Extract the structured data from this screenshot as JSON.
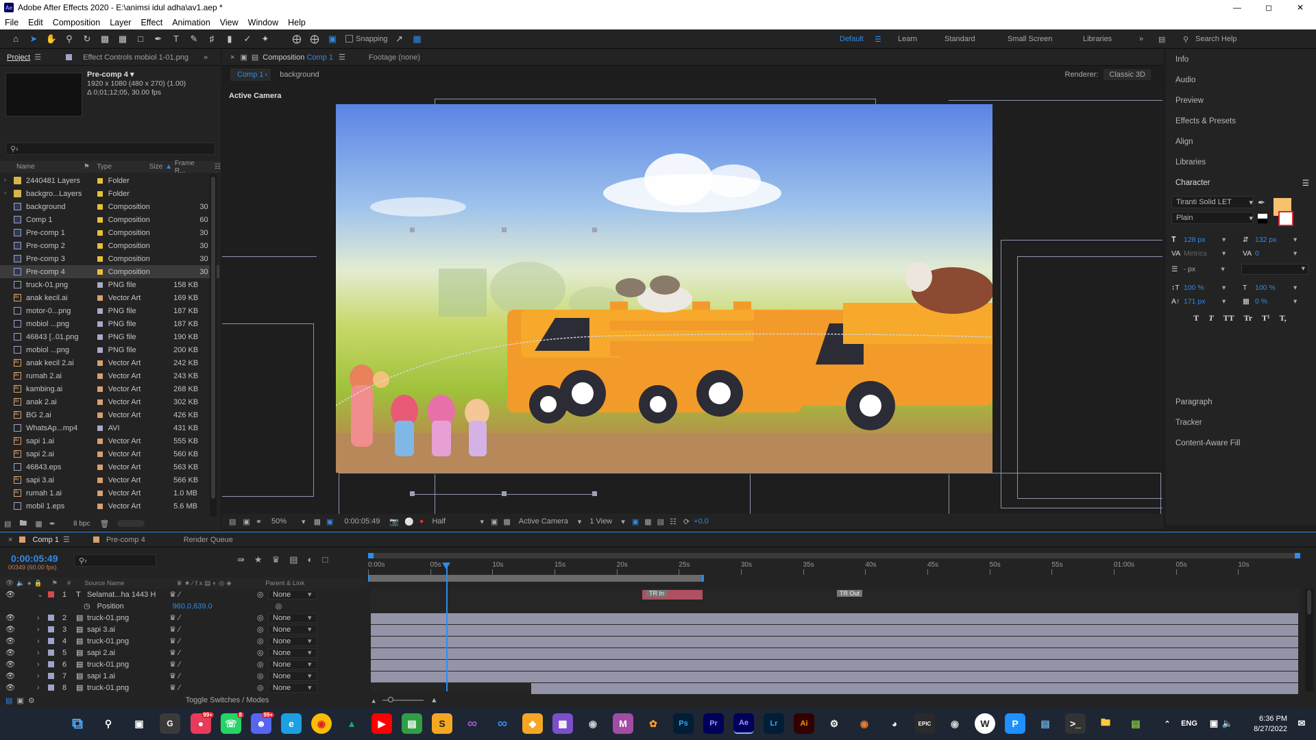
{
  "window": {
    "title": "Adobe After Effects 2020 - E:\\animsi idul adha\\av1.aep *",
    "app_icon": "Ae",
    "controls": [
      "minimize",
      "maximize",
      "close"
    ]
  },
  "menu": [
    "File",
    "Edit",
    "Composition",
    "Layer",
    "Effect",
    "Animation",
    "View",
    "Window",
    "Help"
  ],
  "toolbar": {
    "snapping_label": "Snapping",
    "workspaces": [
      "Default",
      "Learn",
      "Standard",
      "Small Screen",
      "Libraries"
    ],
    "active_workspace": "Default",
    "search_help": "Search Help"
  },
  "project_panel": {
    "tab_project": "Project",
    "tab_effect_controls": "Effect Controls mobiol 1-01.png",
    "selected_item": {
      "name": "Pre-comp 4",
      "resolution": "1920 x 1080  (480 x 270) (1.00)",
      "duration": "Δ 0;01;12;05, 30.00 fps"
    },
    "search_placeholder": "",
    "columns": [
      "Name",
      "Type",
      "Size",
      "Frame R..."
    ],
    "items": [
      {
        "name": "2440481 Layers",
        "type": "Folder",
        "size": "",
        "fr": "",
        "color": "#e8c03a",
        "icon": "folder"
      },
      {
        "name": "backgro...Layers",
        "type": "Folder",
        "size": "",
        "fr": "",
        "color": "#e8c03a",
        "icon": "folder"
      },
      {
        "name": "background",
        "type": "Composition",
        "size": "",
        "fr": "30",
        "color": "#e8c03a",
        "icon": "comp"
      },
      {
        "name": "Comp 1",
        "type": "Composition",
        "size": "",
        "fr": "60",
        "color": "#e8c03a",
        "icon": "comp"
      },
      {
        "name": "Pre-comp 1",
        "type": "Composition",
        "size": "",
        "fr": "30",
        "color": "#e8c03a",
        "icon": "comp"
      },
      {
        "name": "Pre-comp 2",
        "type": "Composition",
        "size": "",
        "fr": "30",
        "color": "#e8c03a",
        "icon": "comp"
      },
      {
        "name": "Pre-comp 3",
        "type": "Composition",
        "size": "",
        "fr": "30",
        "color": "#e8c03a",
        "icon": "comp"
      },
      {
        "name": "Pre-comp 4",
        "type": "Composition",
        "size": "",
        "fr": "30",
        "color": "#e8c03a",
        "icon": "comp",
        "selected": true
      },
      {
        "name": "truck-01.png",
        "type": "PNG file",
        "size": "158 KB",
        "fr": "",
        "color": "#a9a9c8",
        "icon": "file"
      },
      {
        "name": "anak kecil.ai",
        "type": "Vector Art",
        "size": "169 KB",
        "fr": "",
        "color": "#d8a070",
        "icon": "ai"
      },
      {
        "name": "motor-0...png",
        "type": "PNG file",
        "size": "187 KB",
        "fr": "",
        "color": "#a9a9c8",
        "icon": "file"
      },
      {
        "name": "mobiol ...png",
        "type": "PNG file",
        "size": "187 KB",
        "fr": "",
        "color": "#a9a9c8",
        "icon": "file"
      },
      {
        "name": "46843 [..01.png",
        "type": "PNG file",
        "size": "190 KB",
        "fr": "",
        "color": "#a9a9c8",
        "icon": "file"
      },
      {
        "name": "mobiol ...png",
        "type": "PNG file",
        "size": "200 KB",
        "fr": "",
        "color": "#a9a9c8",
        "icon": "file"
      },
      {
        "name": "anak kecil 2.ai",
        "type": "Vector Art",
        "size": "242 KB",
        "fr": "",
        "color": "#d8a070",
        "icon": "ai"
      },
      {
        "name": "rumah 2.ai",
        "type": "Vector Art",
        "size": "243 KB",
        "fr": "",
        "color": "#d8a070",
        "icon": "ai"
      },
      {
        "name": "kambing.ai",
        "type": "Vector Art",
        "size": "268 KB",
        "fr": "",
        "color": "#d8a070",
        "icon": "ai"
      },
      {
        "name": "anak 2.ai",
        "type": "Vector Art",
        "size": "302 KB",
        "fr": "",
        "color": "#d8a070",
        "icon": "ai"
      },
      {
        "name": "BG 2.ai",
        "type": "Vector Art",
        "size": "426 KB",
        "fr": "",
        "color": "#d8a070",
        "icon": "ai"
      },
      {
        "name": "WhatsAp...mp4",
        "type": "AVI",
        "size": "431 KB",
        "fr": "",
        "color": "#a9a9c8",
        "icon": "file"
      },
      {
        "name": "sapi 1.ai",
        "type": "Vector Art",
        "size": "555 KB",
        "fr": "",
        "color": "#d8a070",
        "icon": "ai"
      },
      {
        "name": "sapi 2.ai",
        "type": "Vector Art",
        "size": "560 KB",
        "fr": "",
        "color": "#d8a070",
        "icon": "ai"
      },
      {
        "name": "46843.eps",
        "type": "Vector Art",
        "size": "563 KB",
        "fr": "",
        "color": "#d8a070",
        "icon": "eps"
      },
      {
        "name": "sapi 3.ai",
        "type": "Vector Art",
        "size": "566 KB",
        "fr": "",
        "color": "#d8a070",
        "icon": "ai"
      },
      {
        "name": "rumah 1.ai",
        "type": "Vector Art",
        "size": "1.0 MB",
        "fr": "",
        "color": "#d8a070",
        "icon": "ai"
      },
      {
        "name": "mobil 1.eps",
        "type": "Vector Art",
        "size": "5.6 MB",
        "fr": "",
        "color": "#d8a070",
        "icon": "eps"
      }
    ],
    "bpc": "8 bpc"
  },
  "composition_panel": {
    "tab_label": "Composition",
    "tab_comp": "Comp 1",
    "tab_footage": "Footage (none)",
    "breadcrumbs": [
      "Comp 1",
      "background"
    ],
    "renderer_label": "Renderer:",
    "renderer_value": "Classic 3D",
    "view_label": "Active Camera",
    "zoom": "50%",
    "timecode": "0:00:05:49",
    "resolution": "Half",
    "camera": "Active Camera",
    "views": "1 View",
    "exposure": "+0.0"
  },
  "right_panels": {
    "items": [
      "Info",
      "Audio",
      "Preview",
      "Effects & Presets",
      "Align",
      "Libraries"
    ],
    "character": {
      "title": "Character",
      "font": "Tiranti Solid LET",
      "style": "Plain",
      "size": "128 px",
      "leading": "132 px",
      "kerning": "Metrics",
      "tracking": "0",
      "stroke": "- px",
      "vscale": "100 %",
      "hscale": "100 %",
      "baseline": "171 px",
      "tsume": "0 %",
      "fill_color": "#f7c270",
      "style_buttons": [
        "T",
        "T",
        "TT",
        "Tr",
        "T¹",
        "T,"
      ]
    },
    "bottom_items": [
      "Paragraph",
      "Tracker",
      "Content-Aware Fill"
    ]
  },
  "timeline": {
    "tab_comp": "Comp 1",
    "tab_precomp": "Pre-comp 4",
    "tab_render": "Render Queue",
    "current_time": "0:00:05:49",
    "frame_info": "00349 (60.00 fps)",
    "columns": [
      "Source Name",
      "Parent & Link"
    ],
    "ruler": [
      "0:00s",
      "05s",
      "10s",
      "15s",
      "20s",
      "25s",
      "30s",
      "35s",
      "40s",
      "45s",
      "50s",
      "55s",
      "01:00s",
      "05s",
      "10s"
    ],
    "layers": [
      {
        "num": "1",
        "name": "Selamat...ha 1443 H",
        "type": "text",
        "color": "#d24a4a",
        "parent": "None"
      },
      {
        "num": "2",
        "name": "truck-01.png",
        "type": "img",
        "color": "#9ea3c8",
        "parent": "None"
      },
      {
        "num": "3",
        "name": "sapi 3.ai",
        "type": "img",
        "color": "#9ea3c8",
        "parent": "None"
      },
      {
        "num": "4",
        "name": "truck-01.png",
        "type": "img",
        "color": "#9ea3c8",
        "parent": "None"
      },
      {
        "num": "5",
        "name": "sapi 2.ai",
        "type": "img",
        "color": "#9ea3c8",
        "parent": "None"
      },
      {
        "num": "6",
        "name": "truck-01.png",
        "type": "img",
        "color": "#9ea3c8",
        "parent": "None"
      },
      {
        "num": "7",
        "name": "sapi 1.ai",
        "type": "img",
        "color": "#9ea3c8",
        "parent": "None"
      },
      {
        "num": "8",
        "name": "truck-01.png",
        "type": "img",
        "color": "#9ea3c8",
        "parent": "None"
      }
    ],
    "position_label": "Position",
    "position_value": "960.0,639.0",
    "markers": [
      "TR In",
      "TR Out"
    ],
    "toggle_label": "Toggle Switches / Modes"
  },
  "taskbar": {
    "time": "6:36 PM",
    "date": "8/27/2022",
    "lang": "ENG",
    "badges": [
      "99+",
      "8",
      "99+"
    ]
  }
}
